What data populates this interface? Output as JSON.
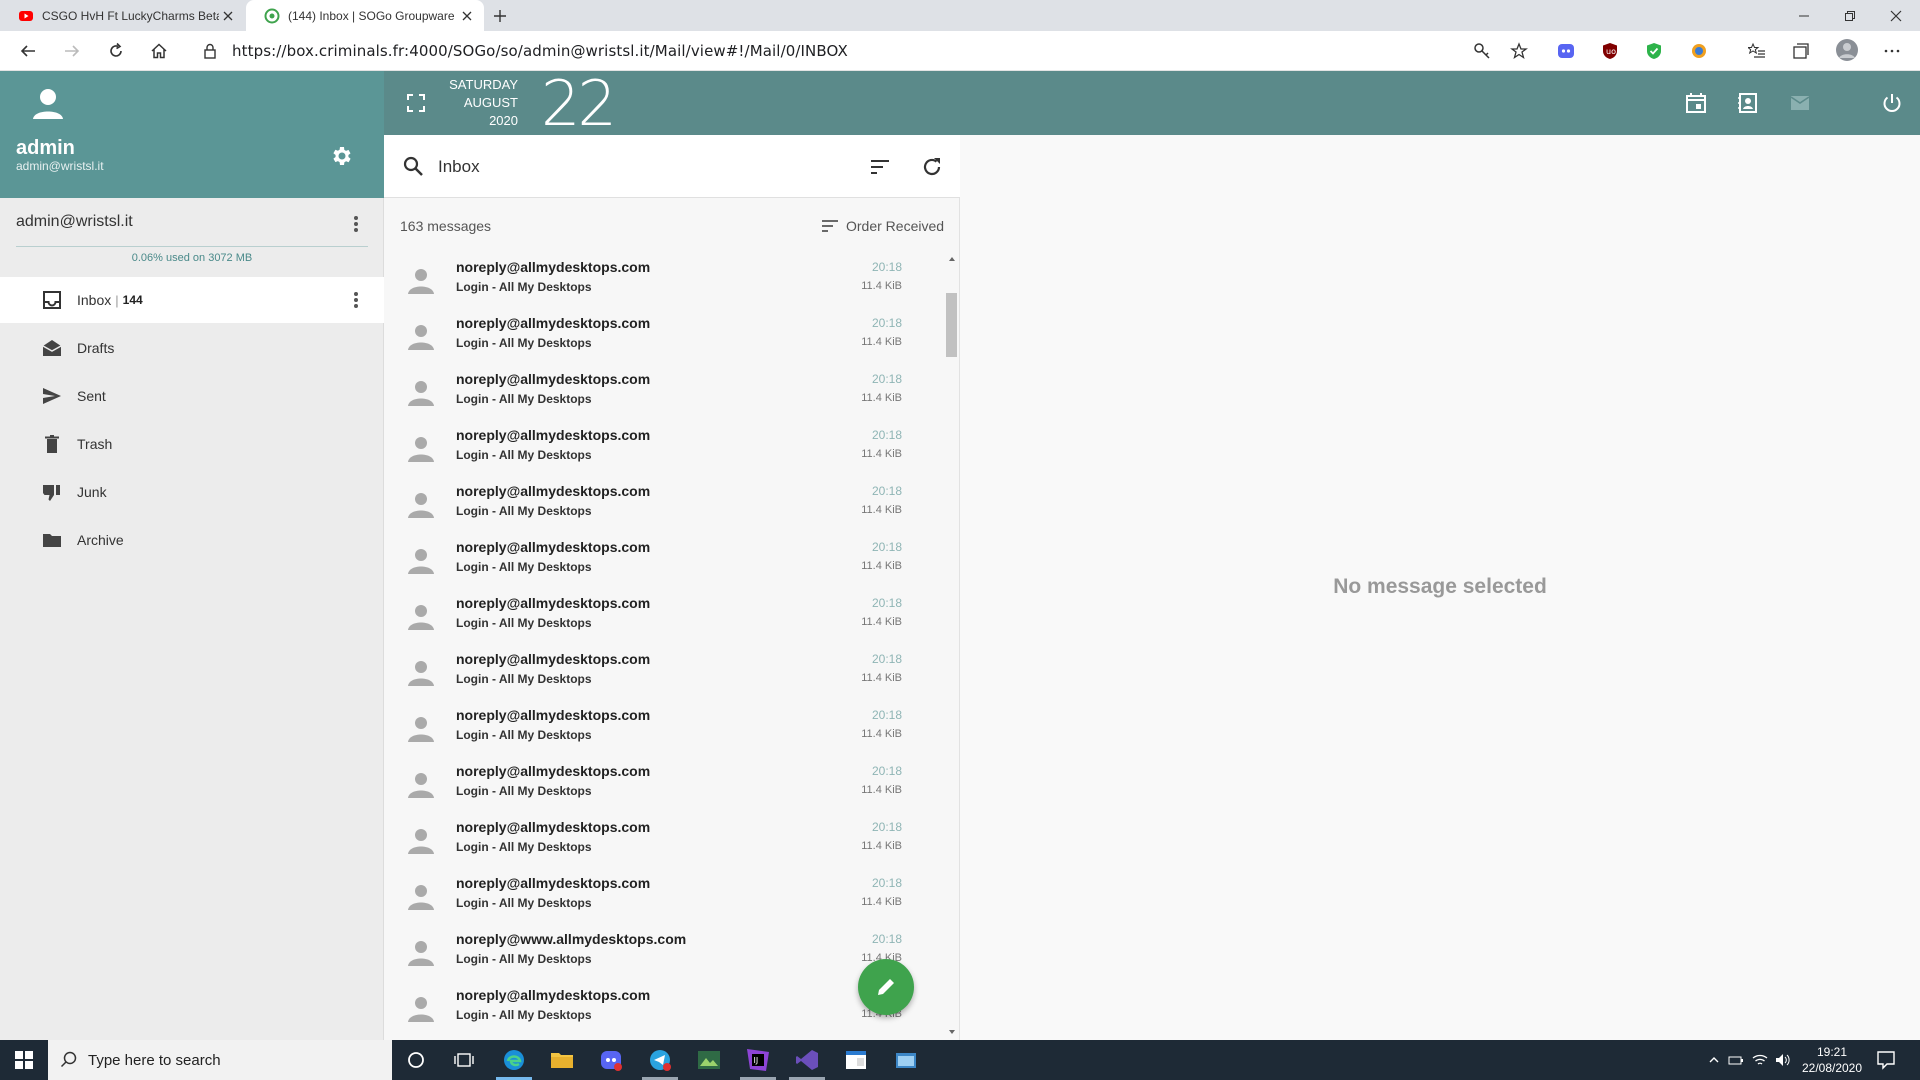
{
  "browser": {
    "tabs": [
      {
        "title": "CSGO HvH Ft LuckyCharms Beta"
      },
      {
        "title": "(144) Inbox | SOGo Groupware"
      }
    ],
    "url": "https://box.criminals.fr:4000/SOGo/so/admin@wristsl.it/Mail/view#!/Mail/0/INBOX"
  },
  "user": {
    "name": "admin",
    "email": "admin@wristsl.it"
  },
  "account": {
    "name": "admin@wristsl.it",
    "quota": "0.06% used on 3072 MB"
  },
  "folders": [
    {
      "label": "Inbox",
      "count": "144",
      "icon": "inbox-icon"
    },
    {
      "label": "Drafts",
      "icon": "drafts-icon"
    },
    {
      "label": "Sent",
      "icon": "sent-icon"
    },
    {
      "label": "Trash",
      "icon": "trash-icon"
    },
    {
      "label": "Junk",
      "icon": "junk-icon"
    },
    {
      "label": "Archive",
      "icon": "archive-icon"
    }
  ],
  "date": {
    "weekday": "SATURDAY",
    "month": "AUGUST",
    "year": "2020",
    "day": "22"
  },
  "list": {
    "mailbox": "Inbox",
    "count": "163 messages",
    "order": "Order Received",
    "messages": [
      {
        "from": "noreply@allmydesktops.com",
        "subject": "Login - All My Desktops",
        "time": "20:18",
        "size": "11.4 KiB"
      },
      {
        "from": "noreply@allmydesktops.com",
        "subject": "Login - All My Desktops",
        "time": "20:18",
        "size": "11.4 KiB"
      },
      {
        "from": "noreply@allmydesktops.com",
        "subject": "Login - All My Desktops",
        "time": "20:18",
        "size": "11.4 KiB"
      },
      {
        "from": "noreply@allmydesktops.com",
        "subject": "Login - All My Desktops",
        "time": "20:18",
        "size": "11.4 KiB"
      },
      {
        "from": "noreply@allmydesktops.com",
        "subject": "Login - All My Desktops",
        "time": "20:18",
        "size": "11.4 KiB"
      },
      {
        "from": "noreply@allmydesktops.com",
        "subject": "Login - All My Desktops",
        "time": "20:18",
        "size": "11.4 KiB"
      },
      {
        "from": "noreply@allmydesktops.com",
        "subject": "Login - All My Desktops",
        "time": "20:18",
        "size": "11.4 KiB"
      },
      {
        "from": "noreply@allmydesktops.com",
        "subject": "Login - All My Desktops",
        "time": "20:18",
        "size": "11.4 KiB"
      },
      {
        "from": "noreply@allmydesktops.com",
        "subject": "Login - All My Desktops",
        "time": "20:18",
        "size": "11.4 KiB"
      },
      {
        "from": "noreply@allmydesktops.com",
        "subject": "Login - All My Desktops",
        "time": "20:18",
        "size": "11.4 KiB"
      },
      {
        "from": "noreply@allmydesktops.com",
        "subject": "Login - All My Desktops",
        "time": "20:18",
        "size": "11.4 KiB"
      },
      {
        "from": "noreply@allmydesktops.com",
        "subject": "Login - All My Desktops",
        "time": "20:18",
        "size": "11.4 KiB"
      },
      {
        "from": "noreply@www.allmydesktops.com",
        "subject": "Login - All My Desktops",
        "time": "20:18",
        "size": "11.4 KiB"
      },
      {
        "from": "noreply@allmydesktops.com",
        "subject": "Login - All My Desktops",
        "time": "20:18",
        "size": "11.4 KiB"
      }
    ]
  },
  "viewer": {
    "empty": "No message selected"
  },
  "taskbar": {
    "search_placeholder": "Type here to search",
    "time": "19:21",
    "date": "22/08/2020"
  },
  "colors": {
    "user_panel": "#5b9696",
    "header": "#5b8a8a",
    "fab": "#3fa34d"
  }
}
